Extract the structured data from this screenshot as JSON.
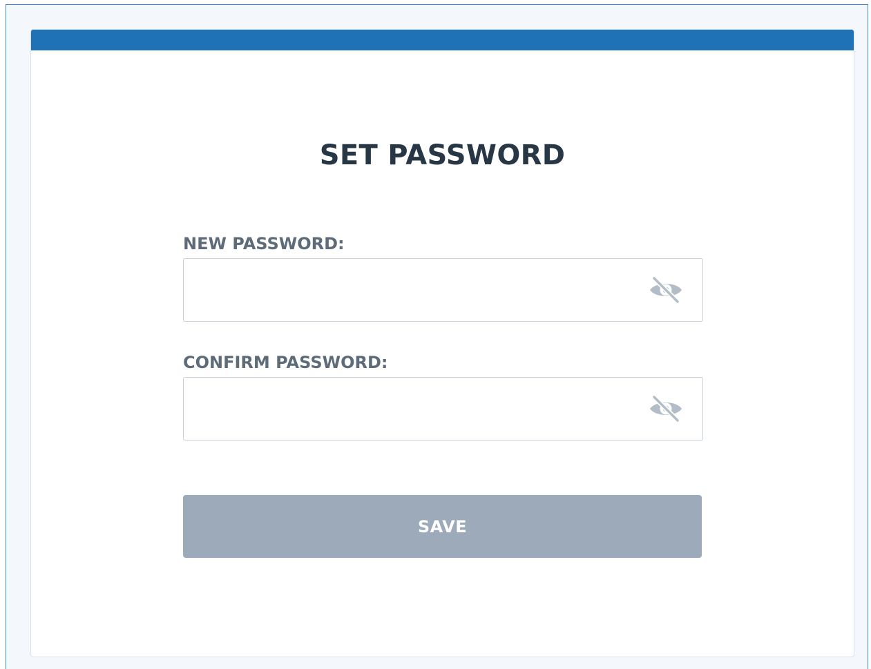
{
  "page": {
    "title": "SET PASSWORD"
  },
  "form": {
    "new_password": {
      "label": "NEW PASSWORD:",
      "value": "",
      "placeholder": "",
      "toggle_icon": "eye-slash-icon"
    },
    "confirm_password": {
      "label": "CONFIRM PASSWORD:",
      "value": "",
      "placeholder": "",
      "toggle_icon": "eye-slash-icon"
    },
    "save_label": "SAVE"
  },
  "colors": {
    "accent": "#2072b7",
    "title_text": "#273746",
    "label_text": "#5e6b79",
    "button_disabled": "#9daab9",
    "icon_gray": "#b3bdc8"
  }
}
